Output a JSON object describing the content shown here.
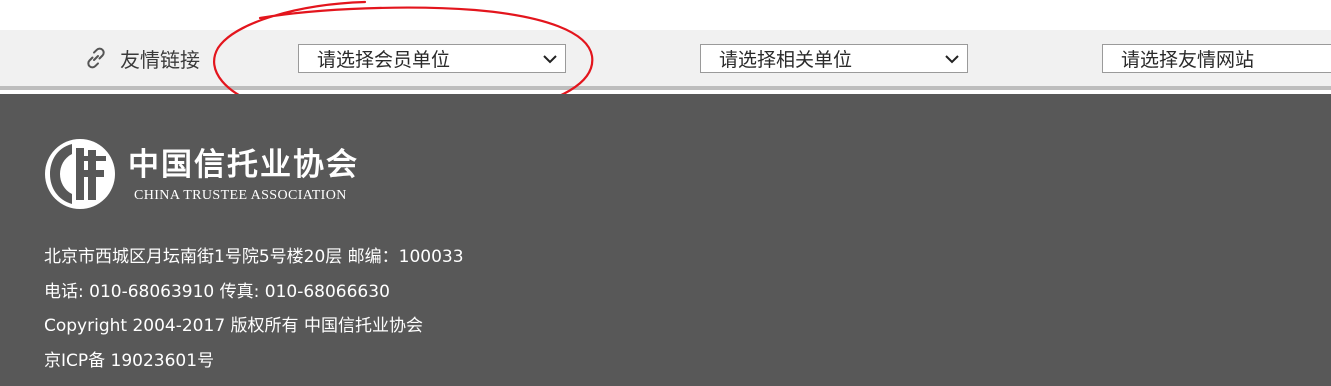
{
  "friend_links": {
    "label": "友情链接",
    "selects": [
      {
        "selected": "请选择会员单位"
      },
      {
        "selected": "请选择相关单位"
      },
      {
        "selected": "请选择友情网站"
      }
    ]
  },
  "footer": {
    "logo": {
      "cn": "中国信托业协会",
      "en": "CHINA TRUSTEE ASSOCIATION"
    },
    "address": "北京市西城区月坛南街1号院5号楼20层 邮编：100033",
    "phone_fax": "电话: 010-68063910 传真: 010-68066630",
    "copyright": "Copyright 2004-2017 版权所有 中国信托业协会",
    "icp": "京ICP备 19023601号"
  },
  "colors": {
    "links_bar_bg": "#f1f1f1",
    "footer_bg": "#585858",
    "annotation": "#e3151d"
  },
  "icons": {
    "links_icon": "link-icon",
    "select_arrow": "chevron-down-icon"
  }
}
